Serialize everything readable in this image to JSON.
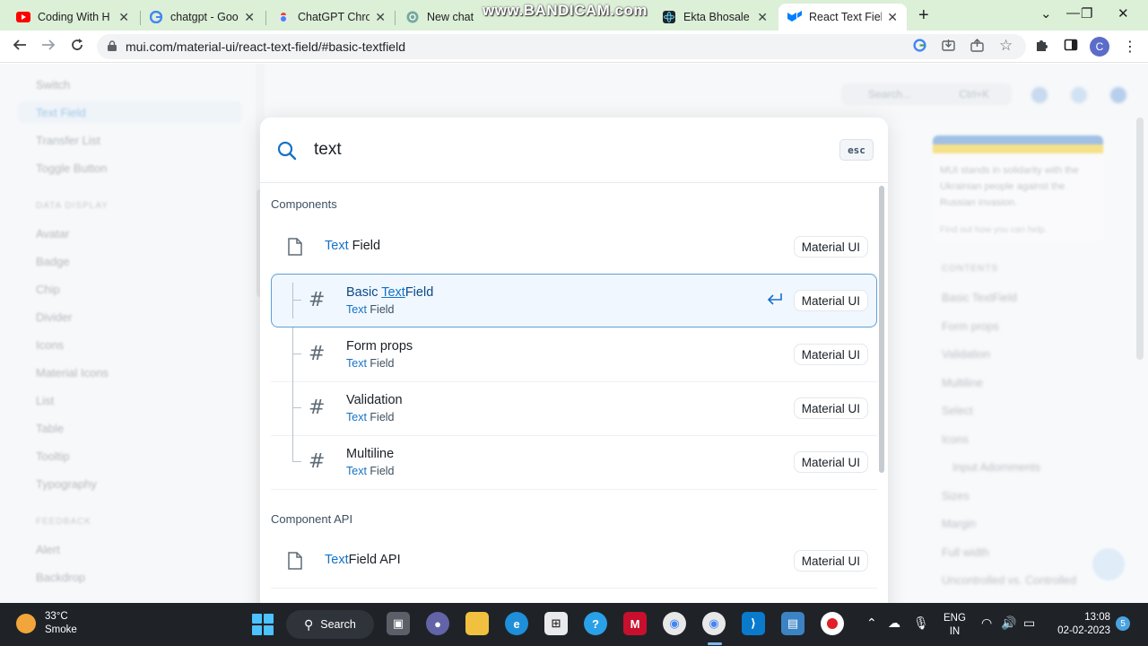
{
  "browser": {
    "tabs": [
      {
        "title": "Coding With H",
        "icon": "youtube-icon",
        "active": false
      },
      {
        "title": "chatgpt - Goo",
        "icon": "google-icon",
        "active": false
      },
      {
        "title": "ChatGPT Chrom",
        "icon": "chrome-web-store-icon",
        "active": false
      },
      {
        "title": "New chat",
        "icon": "openai-icon",
        "active": false
      },
      {
        "title": "Ekta Bhosale",
        "icon": "react-icon",
        "active": false
      },
      {
        "title": "React Text Field",
        "icon": "mui-icon",
        "active": true
      }
    ],
    "recorder_watermark": "www.BANDICAM.com",
    "url": "mui.com/material-ui/react-text-field/#basic-textfield",
    "profile_initial": "C",
    "colors": {
      "tabbar": "#dcefd7",
      "accent": "#1572c6"
    }
  },
  "background": {
    "left_nav": {
      "items": [
        "Switch",
        "Text Field",
        "Transfer List",
        "Toggle Button",
        "Avatar",
        "Badge",
        "Chip",
        "Divider",
        "Icons",
        "Material Icons",
        "List",
        "Table",
        "Tooltip",
        "Typography",
        "Alert",
        "Backdrop"
      ],
      "headings": [
        "DATA DISPLAY",
        "FEEDBACK"
      ]
    },
    "search_placeholder": "Search...",
    "search_shortcut": "Ctrl+K",
    "toc_items": [
      "Basic TextField",
      "Form props",
      "Validation",
      "Multiline",
      "Select",
      "Icons",
      "Input Adornments",
      "Sizes",
      "Margin",
      "Full width",
      "Uncontrolled vs. Controlled"
    ],
    "toc_heading": "CONTENTS",
    "banner_text": "MUI stands in solidarity with the Ukrainian people against the Russian invasion.",
    "banner_link": "Find out how you can help."
  },
  "search_modal": {
    "query": "text",
    "esc_label": "esc",
    "sections": [
      {
        "title": "Components",
        "hits": [
          {
            "title_hl": "Text",
            "title_rest": " Field",
            "tag": "Material UI"
          },
          {
            "title_pre": "Basic ",
            "title_hl": "Text",
            "title_rest": "Field",
            "sub_hl": "Text",
            "sub_rest": " Field",
            "tag": "Material UI",
            "selected": true
          },
          {
            "title": "Form props",
            "sub_hl": "Text",
            "sub_rest": " Field",
            "tag": "Material UI"
          },
          {
            "title": "Validation",
            "sub_hl": "Text",
            "sub_rest": " Field",
            "tag": "Material UI"
          },
          {
            "title": "Multiline",
            "sub_hl": "Text",
            "sub_rest": " Field",
            "tag": "Material UI"
          }
        ]
      },
      {
        "title": "Component API",
        "hits": [
          {
            "title_hl": "Text",
            "title_rest": "Field API",
            "tag": "Material UI"
          }
        ]
      }
    ]
  },
  "taskbar": {
    "weather": {
      "temp": "33°C",
      "condition": "Smoke"
    },
    "search_label": "Search",
    "lang": {
      "line1": "ENG",
      "line2": "IN"
    },
    "clock": {
      "time": "13:08",
      "date": "02-02-2023"
    },
    "notifications": "5"
  }
}
